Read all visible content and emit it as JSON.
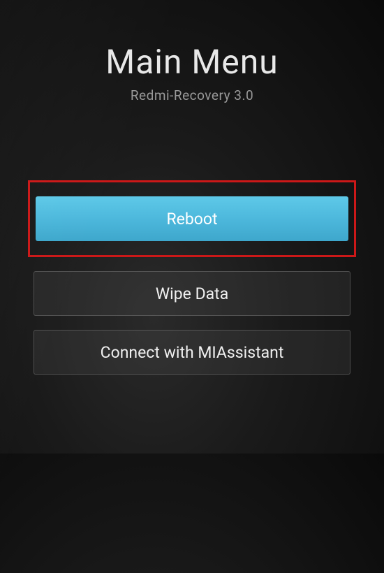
{
  "header": {
    "title": "Main Menu",
    "subtitle": "Redmi-Recovery 3.0"
  },
  "menu": {
    "items": [
      {
        "label": "Reboot",
        "selected": true,
        "highlighted": true
      },
      {
        "label": "Wipe Data",
        "selected": false,
        "highlighted": false
      },
      {
        "label": "Connect with MIAssistant",
        "selected": false,
        "highlighted": false
      }
    ]
  }
}
